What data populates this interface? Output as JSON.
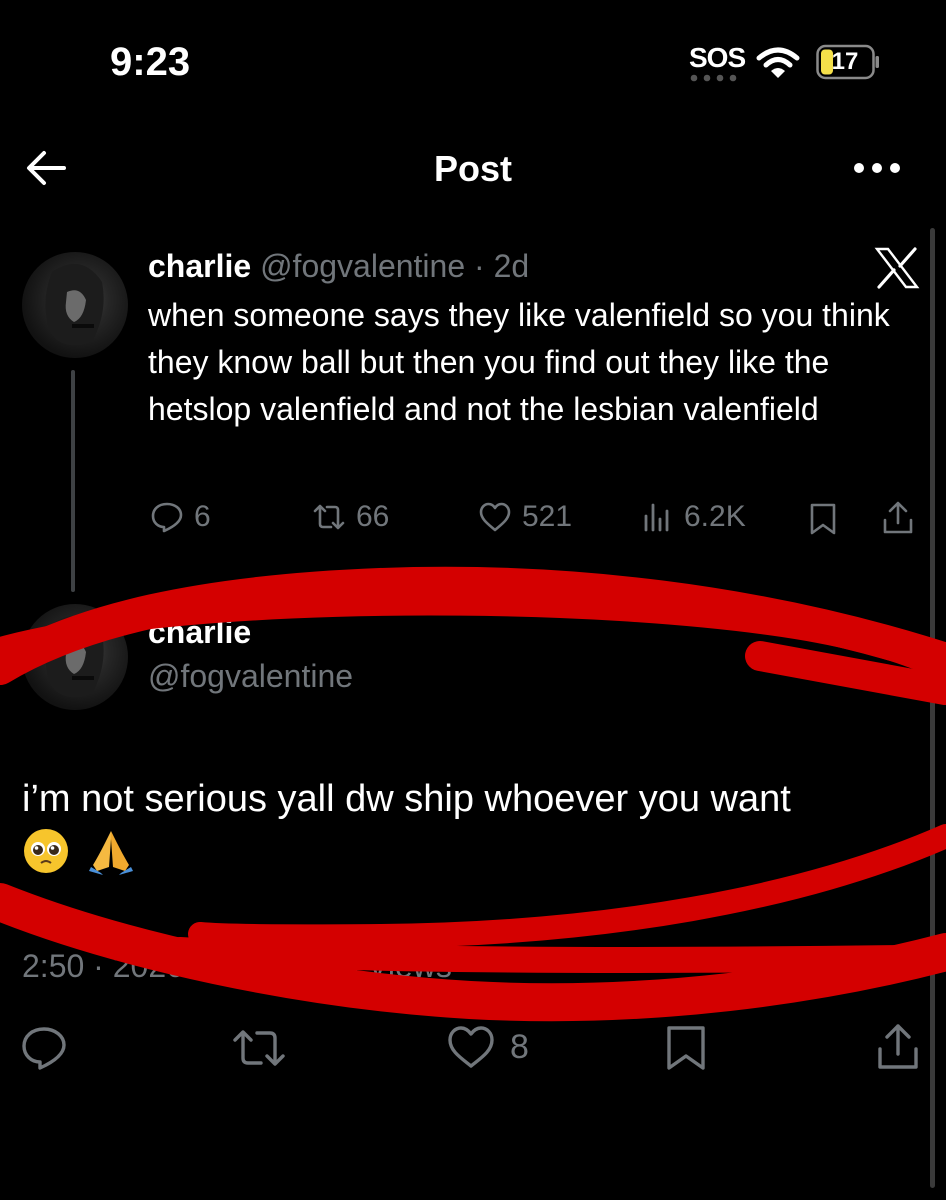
{
  "status_bar": {
    "time": "9:23",
    "sos": "SOS",
    "battery": "17"
  },
  "nav": {
    "title": "Post"
  },
  "parent_post": {
    "name": "charlie",
    "handle": "@fogvalentine",
    "age": "· 2d",
    "text": "when someone says they like valenfield so you think they know ball but then you find out they like the hetslop valenfield and not the lesbian valenfield",
    "replies": "6",
    "reposts": "66",
    "likes": "521",
    "views": "6.2K"
  },
  "main_post": {
    "name": "charlie",
    "handle": "@fogvalentine",
    "text": "i’m not serious yall dw ship whoever you want",
    "meta": "2:50 · 2026-06-12 · 645 Views",
    "likes": "8"
  },
  "colors": {
    "background": "#000000",
    "muted": "#71767b",
    "scribble": "#d40000",
    "battery": "#f5e04a"
  },
  "icons": [
    "back-arrow-icon",
    "more-icon",
    "x-logo-icon",
    "reply-icon",
    "repost-icon",
    "like-icon",
    "views-icon",
    "bookmark-icon",
    "share-icon",
    "wifi-icon",
    "battery-icon",
    "pleading-face-emoji",
    "folded-hands-emoji"
  ]
}
